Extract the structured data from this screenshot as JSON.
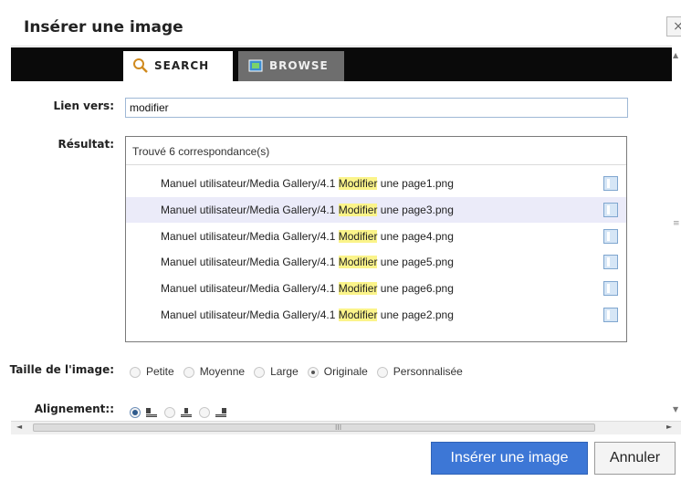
{
  "dialog": {
    "title": "Insérer une image",
    "close_symbol": "×"
  },
  "tabs": [
    {
      "label": "SEARCH",
      "icon": "magnifier-icon",
      "active": true
    },
    {
      "label": "BROWSE",
      "icon": "folder-icon",
      "active": false
    }
  ],
  "form": {
    "link_label": "Lien vers:",
    "link_value": "modifier",
    "result_label": "Résultat:",
    "result_count_text": "Trouvé 6 correspondance(s)",
    "results": [
      {
        "prefix": "Manuel utilisateur/Media Gallery/4.1 ",
        "highlight": "Modifier",
        "suffix": " une page1.png",
        "selected": false
      },
      {
        "prefix": "Manuel utilisateur/Media Gallery/4.1 ",
        "highlight": "Modifier",
        "suffix": " une page3.png",
        "selected": true
      },
      {
        "prefix": "Manuel utilisateur/Media Gallery/4.1 ",
        "highlight": "Modifier",
        "suffix": " une page4.png",
        "selected": false
      },
      {
        "prefix": "Manuel utilisateur/Media Gallery/4.1 ",
        "highlight": "Modifier",
        "suffix": " une page5.png",
        "selected": false
      },
      {
        "prefix": "Manuel utilisateur/Media Gallery/4.1 ",
        "highlight": "Modifier",
        "suffix": " une page6.png",
        "selected": false
      },
      {
        "prefix": "Manuel utilisateur/Media Gallery/4.1 ",
        "highlight": "Modifier",
        "suffix": " une page2.png",
        "selected": false
      }
    ],
    "size_label": "Taille de l'image:",
    "size_options": [
      {
        "label": "Petite",
        "checked": false
      },
      {
        "label": "Moyenne",
        "checked": false
      },
      {
        "label": "Large",
        "checked": false
      },
      {
        "label": "Originale",
        "checked": true
      },
      {
        "label": "Personnalisée",
        "checked": false
      }
    ],
    "align_label": "Alignement::",
    "align_options": [
      {
        "name": "align-left-icon",
        "checked": true
      },
      {
        "name": "align-center-icon",
        "checked": false
      },
      {
        "name": "align-right-icon",
        "checked": false
      }
    ]
  },
  "buttons": {
    "insert_label": "Insérer une image",
    "cancel_label": "Annuler"
  },
  "colors": {
    "tab_bar": "#0a0a0a",
    "primary_button": "#3d77d6",
    "highlight": "#fbf48a",
    "selected_row": "#ebebf9"
  }
}
